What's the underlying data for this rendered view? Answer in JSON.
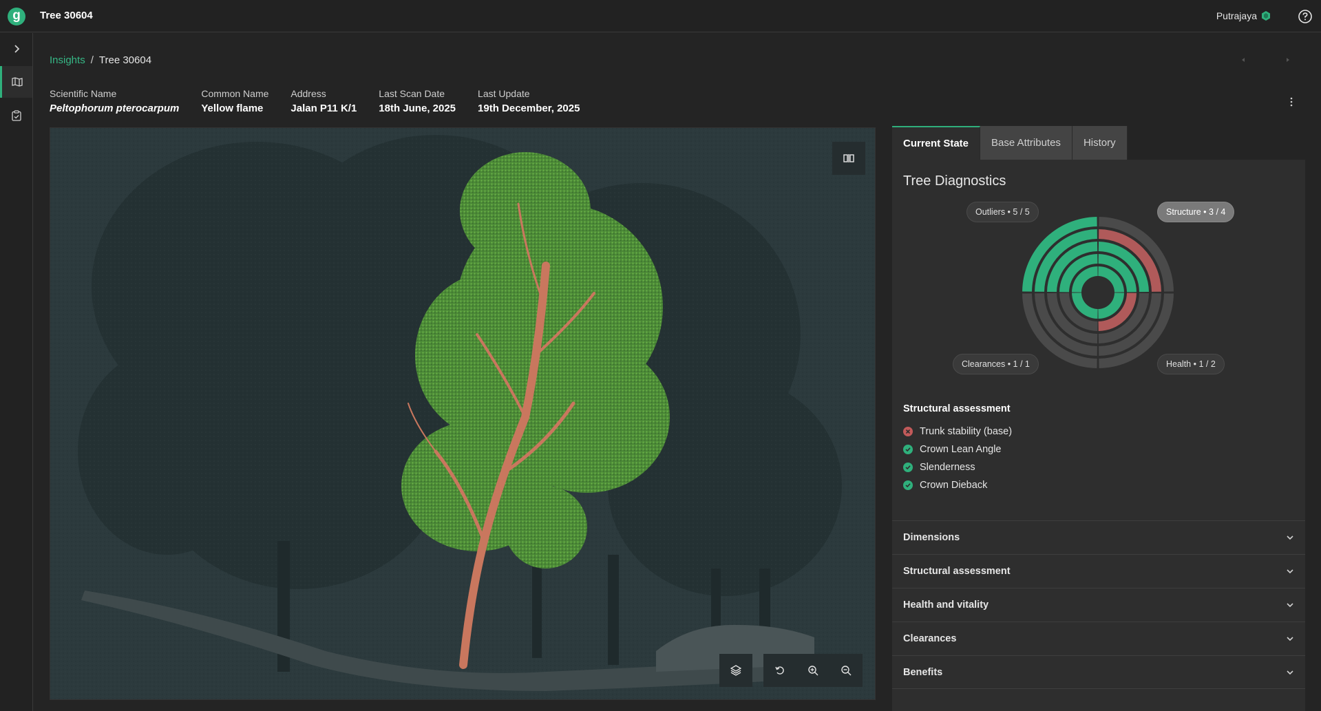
{
  "app": {
    "logo_letter": "g",
    "title": "Tree 30604",
    "city": "Putrajaya"
  },
  "breadcrumb": {
    "parent": "Insights",
    "separator": "/",
    "current": "Tree 30604"
  },
  "meta": [
    {
      "label": "Scientific Name",
      "value": "Peltophorum pterocarpum",
      "italic": true
    },
    {
      "label": "Common Name",
      "value": "Yellow flame"
    },
    {
      "label": "Address",
      "value": "Jalan P11 K/1"
    },
    {
      "label": "Last Scan Date",
      "value": "18th June, 2025"
    },
    {
      "label": "Last Update",
      "value": "19th December, 2025"
    }
  ],
  "tabs": [
    {
      "label": "Current State",
      "active": true
    },
    {
      "label": "Base Attributes"
    },
    {
      "label": "History"
    }
  ],
  "diagnostics": {
    "title": "Tree Diagnostics",
    "pills": {
      "outliers": "Outliers  •  5 / 5",
      "structure": "Structure  •  3 / 4",
      "clearances": "Clearances  •  1 / 1",
      "health": "Health  •  1 / 2"
    },
    "colors": {
      "pass": "#2fb07c",
      "fail": "#b05a5a",
      "empty": "#4a4a4a"
    }
  },
  "structural_assessment": {
    "title": "Structural assessment",
    "items": [
      {
        "label": "Trunk stability (base)",
        "status": "fail"
      },
      {
        "label": "Crown Lean Angle",
        "status": "pass"
      },
      {
        "label": "Slenderness",
        "status": "pass"
      },
      {
        "label": "Crown Dieback",
        "status": "pass"
      }
    ]
  },
  "accordion": [
    "Dimensions",
    "Structural assessment",
    "Health and vitality",
    "Clearances",
    "Benefits"
  ],
  "icons": {
    "sidebar_toggle": "chevron-right-icon",
    "map": "map-icon",
    "clipboard": "clipboard-check-icon",
    "split_view": "split-view-icon",
    "layers": "layers-icon",
    "reset": "rotate-ccw-icon",
    "zoom_in": "zoom-in-icon",
    "zoom_out": "zoom-out-icon"
  }
}
